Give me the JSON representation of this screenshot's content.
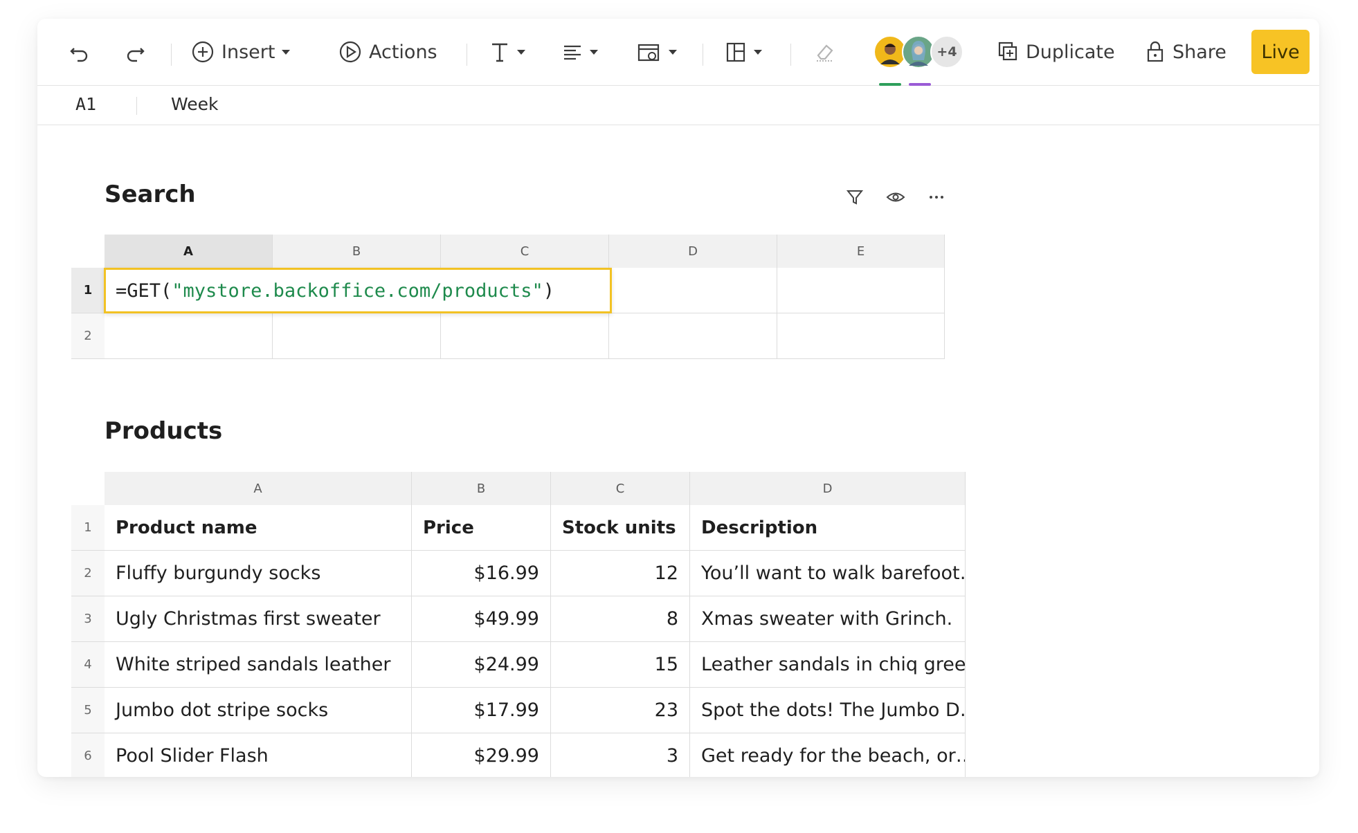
{
  "toolbar": {
    "insert_label": "Insert",
    "actions_label": "Actions",
    "collaborators_more": "+4",
    "duplicate_label": "Duplicate",
    "share_label": "Share",
    "live_label": "Live",
    "colors": {
      "live_bg": "#f7c325",
      "presence_1": "#2e9f5b",
      "presence_2": "#9a5bd6"
    }
  },
  "formula_bar": {
    "cell_ref": "A1",
    "value": "Week"
  },
  "search_section": {
    "title": "Search",
    "icons": [
      "filter-icon",
      "eye-icon",
      "more-icon"
    ],
    "columns": [
      "A",
      "B",
      "C",
      "D",
      "E"
    ],
    "rows": [
      "1",
      "2"
    ],
    "formula_prefix": "=GET(",
    "formula_string": "\"mystore.backoffice.com/products\"",
    "formula_suffix": ")"
  },
  "products_section": {
    "title": "Products",
    "columns": [
      "A",
      "B",
      "C",
      "D"
    ],
    "row_numbers": [
      "1",
      "2",
      "3",
      "4",
      "5",
      "6"
    ],
    "headers": [
      "Product name",
      "Price",
      "Stock units",
      "Description"
    ],
    "rows": [
      [
        "Fluffy burgundy socks",
        "$16.99",
        "12",
        "You’ll want to walk barefoot…"
      ],
      [
        "Ugly Christmas first sweater",
        "$49.99",
        "8",
        "Xmas sweater with Grinch."
      ],
      [
        "White striped sandals leather",
        "$24.99",
        "15",
        "Leather sandals in chiq gree…"
      ],
      [
        "Jumbo dot stripe socks",
        "$17.99",
        "23",
        "Spot the dots! The Jumbo D…"
      ],
      [
        "Pool Slider Flash",
        "$29.99",
        "3",
        "Get ready for the beach, or…"
      ]
    ]
  }
}
